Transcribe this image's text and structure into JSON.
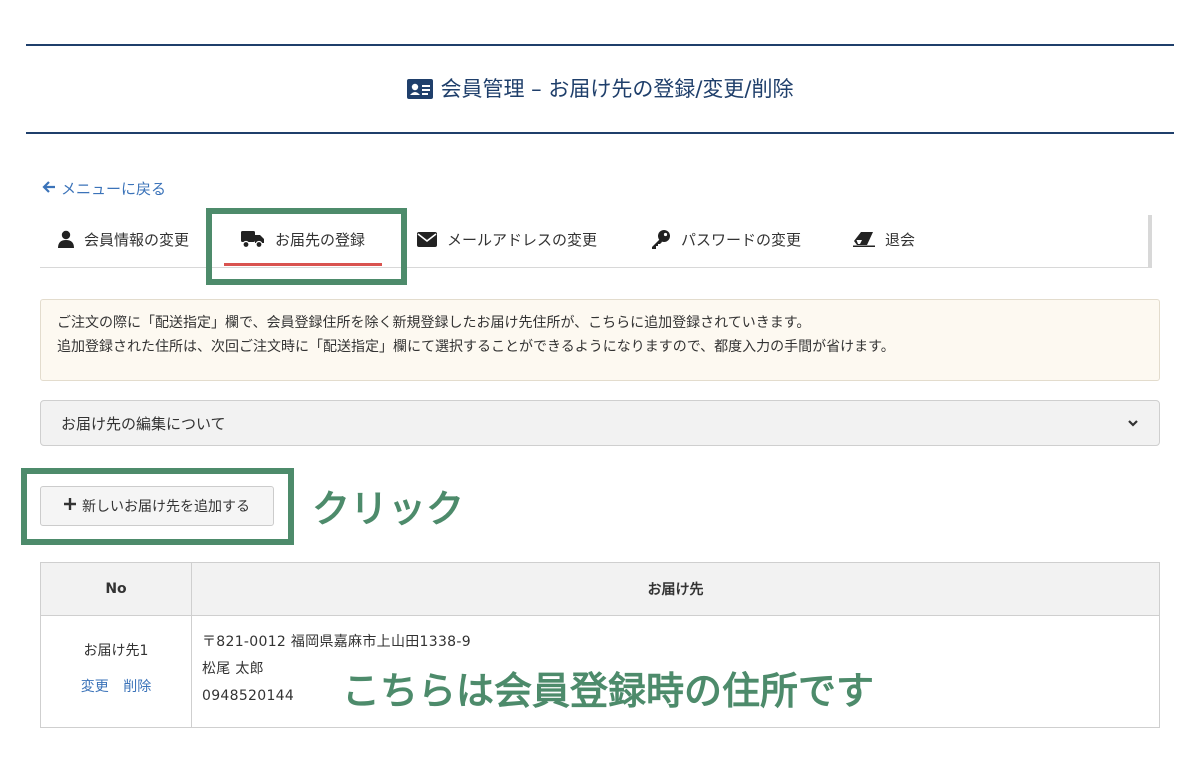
{
  "header": {
    "title": "会員管理 – お届け先の登録/変更/削除",
    "icon": "id-card-icon"
  },
  "back_link": {
    "label": "メニューに戻る",
    "icon": "arrow-left-icon"
  },
  "tabs": [
    {
      "label": "会員情報の変更",
      "icon": "user-icon",
      "active": false
    },
    {
      "label": "お届先の登録",
      "icon": "truck-icon",
      "active": true
    },
    {
      "label": "メールアドレスの変更",
      "icon": "envelope-icon",
      "active": false
    },
    {
      "label": "パスワードの変更",
      "icon": "key-icon",
      "active": false
    },
    {
      "label": "退会",
      "icon": "eraser-icon",
      "active": false
    }
  ],
  "notice": {
    "line1": "ご注文の際に「配送指定」欄で、会員登録住所を除く新規登録したお届け先住所が、こちらに追加登録されていきます。",
    "line2": "追加登録された住所は、次回ご注文時に「配送指定」欄にて選択することができるようになりますので、都度入力の手間が省けます。"
  },
  "accordion": {
    "label": "お届け先の編集について",
    "icon": "chevron-down-icon"
  },
  "add_button": {
    "label": "新しいお届け先を追加する",
    "icon": "plus-icon"
  },
  "annotations": {
    "click": "クリック",
    "member_address": "こちらは会員登録時の住所です"
  },
  "table": {
    "headers": {
      "no": "No",
      "destination": "お届け先"
    },
    "rows": [
      {
        "no": "お届け先1",
        "edit": "変更",
        "delete": "削除",
        "address": "〒821-0012 福岡県嘉麻市上山田1338-9",
        "name": "松尾 太郎",
        "phone": "0948520144"
      }
    ]
  },
  "colors": {
    "navy": "#1f3f6b",
    "link": "#3b73b9",
    "active_tab": "#d9534f",
    "highlight": "#4d8b6b"
  }
}
